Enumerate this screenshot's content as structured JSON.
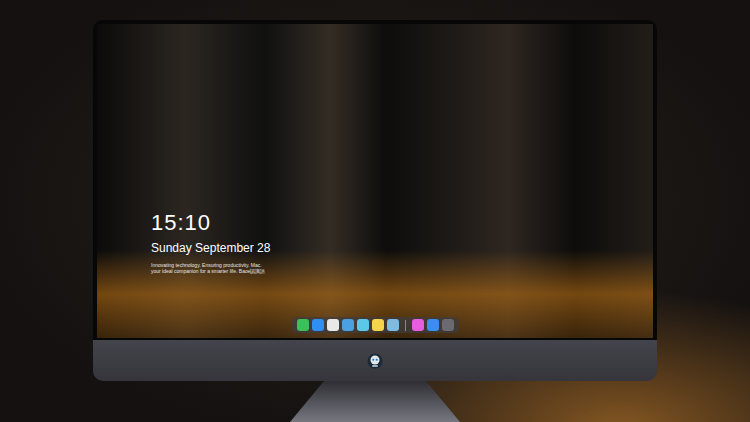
{
  "lock_screen": {
    "time": "15:10",
    "date": "Sunday September 28",
    "tagline": [
      "Innovating technology. Ensuring productivity. Mac.",
      "your ideal companion for a smarter life. Baoe認識講"
    ]
  },
  "dock": {
    "apps": [
      {
        "kind": "app",
        "color": "#3cc15a"
      },
      {
        "kind": "app",
        "color": "#2f8ff0"
      },
      {
        "kind": "app",
        "color": "#e8e8e8"
      },
      {
        "kind": "app",
        "color": "#4aa0e0"
      },
      {
        "kind": "app",
        "color": "#5cc8e8"
      },
      {
        "kind": "app",
        "color": "#f5d34a"
      },
      {
        "kind": "app",
        "color": "#7dbbe0"
      },
      {
        "kind": "separator",
        "color": "#8a8a8a"
      },
      {
        "kind": "app",
        "color": "#e85ce0"
      },
      {
        "kind": "app",
        "color": "#3a8ef0"
      },
      {
        "kind": "app",
        "color": "#6a6a70"
      }
    ]
  }
}
